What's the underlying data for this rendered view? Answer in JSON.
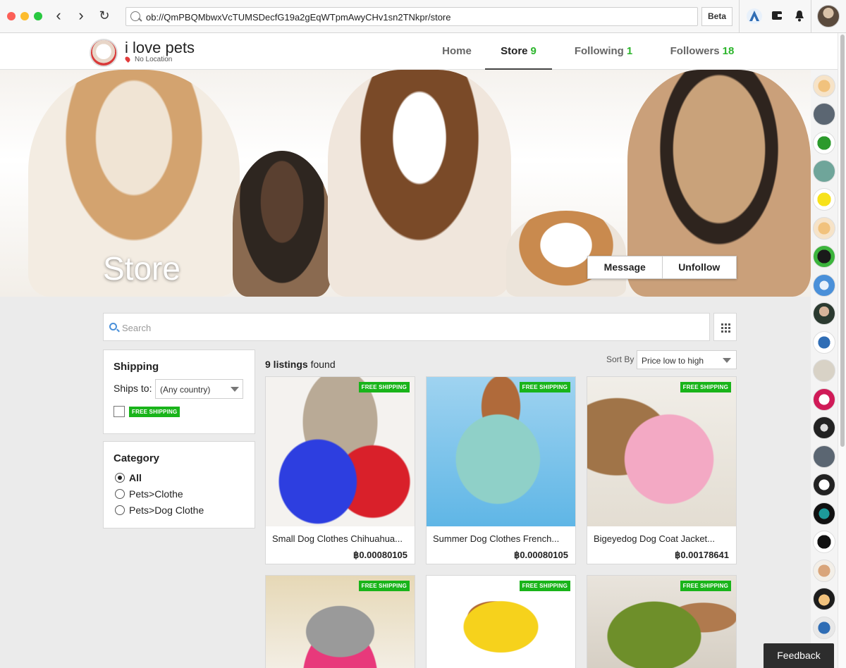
{
  "browser": {
    "url": "ob://QmPBQMbwxVcTUMSDecfG19a2gEqWTpmAwyCHv1sn2TNkpr/store",
    "beta_label": "Beta"
  },
  "store": {
    "name": "i love pets",
    "location": "No Location"
  },
  "nav_tabs": [
    {
      "label": "Home",
      "count": ""
    },
    {
      "label": "Store",
      "count": "9"
    },
    {
      "label": "Following",
      "count": "1"
    },
    {
      "label": "Followers",
      "count": "18"
    }
  ],
  "hero": {
    "title": "Store",
    "message_label": "Message",
    "unfollow_label": "Unfollow"
  },
  "search": {
    "placeholder": "Search"
  },
  "shipping_panel": {
    "title": "Shipping",
    "ships_to_label": "Ships to:",
    "country_value": "(Any country)",
    "free_shipping_badge": "FREE SHIPPING"
  },
  "category_panel": {
    "title": "Category",
    "options": [
      "All",
      "Pets>Clothe",
      "Pets>Dog Clothe"
    ]
  },
  "listings": {
    "count": "9 listings",
    "found_text": "found",
    "sort_label": "Sort By",
    "sort_value": "Price low to high",
    "badge": "FREE SHIPPING",
    "items": [
      {
        "title": "Small Dog Clothes Chihuahua...",
        "price": "฿0.00080105"
      },
      {
        "title": "Summer Dog Clothes French...",
        "price": "฿0.00080105"
      },
      {
        "title": "Bigeyedog Dog Coat Jacket...",
        "price": "฿0.00178641"
      }
    ]
  },
  "feedback_label": "Feedback",
  "colors": {
    "accent_green": "#2bb52b",
    "badge_green": "#19b41a"
  }
}
